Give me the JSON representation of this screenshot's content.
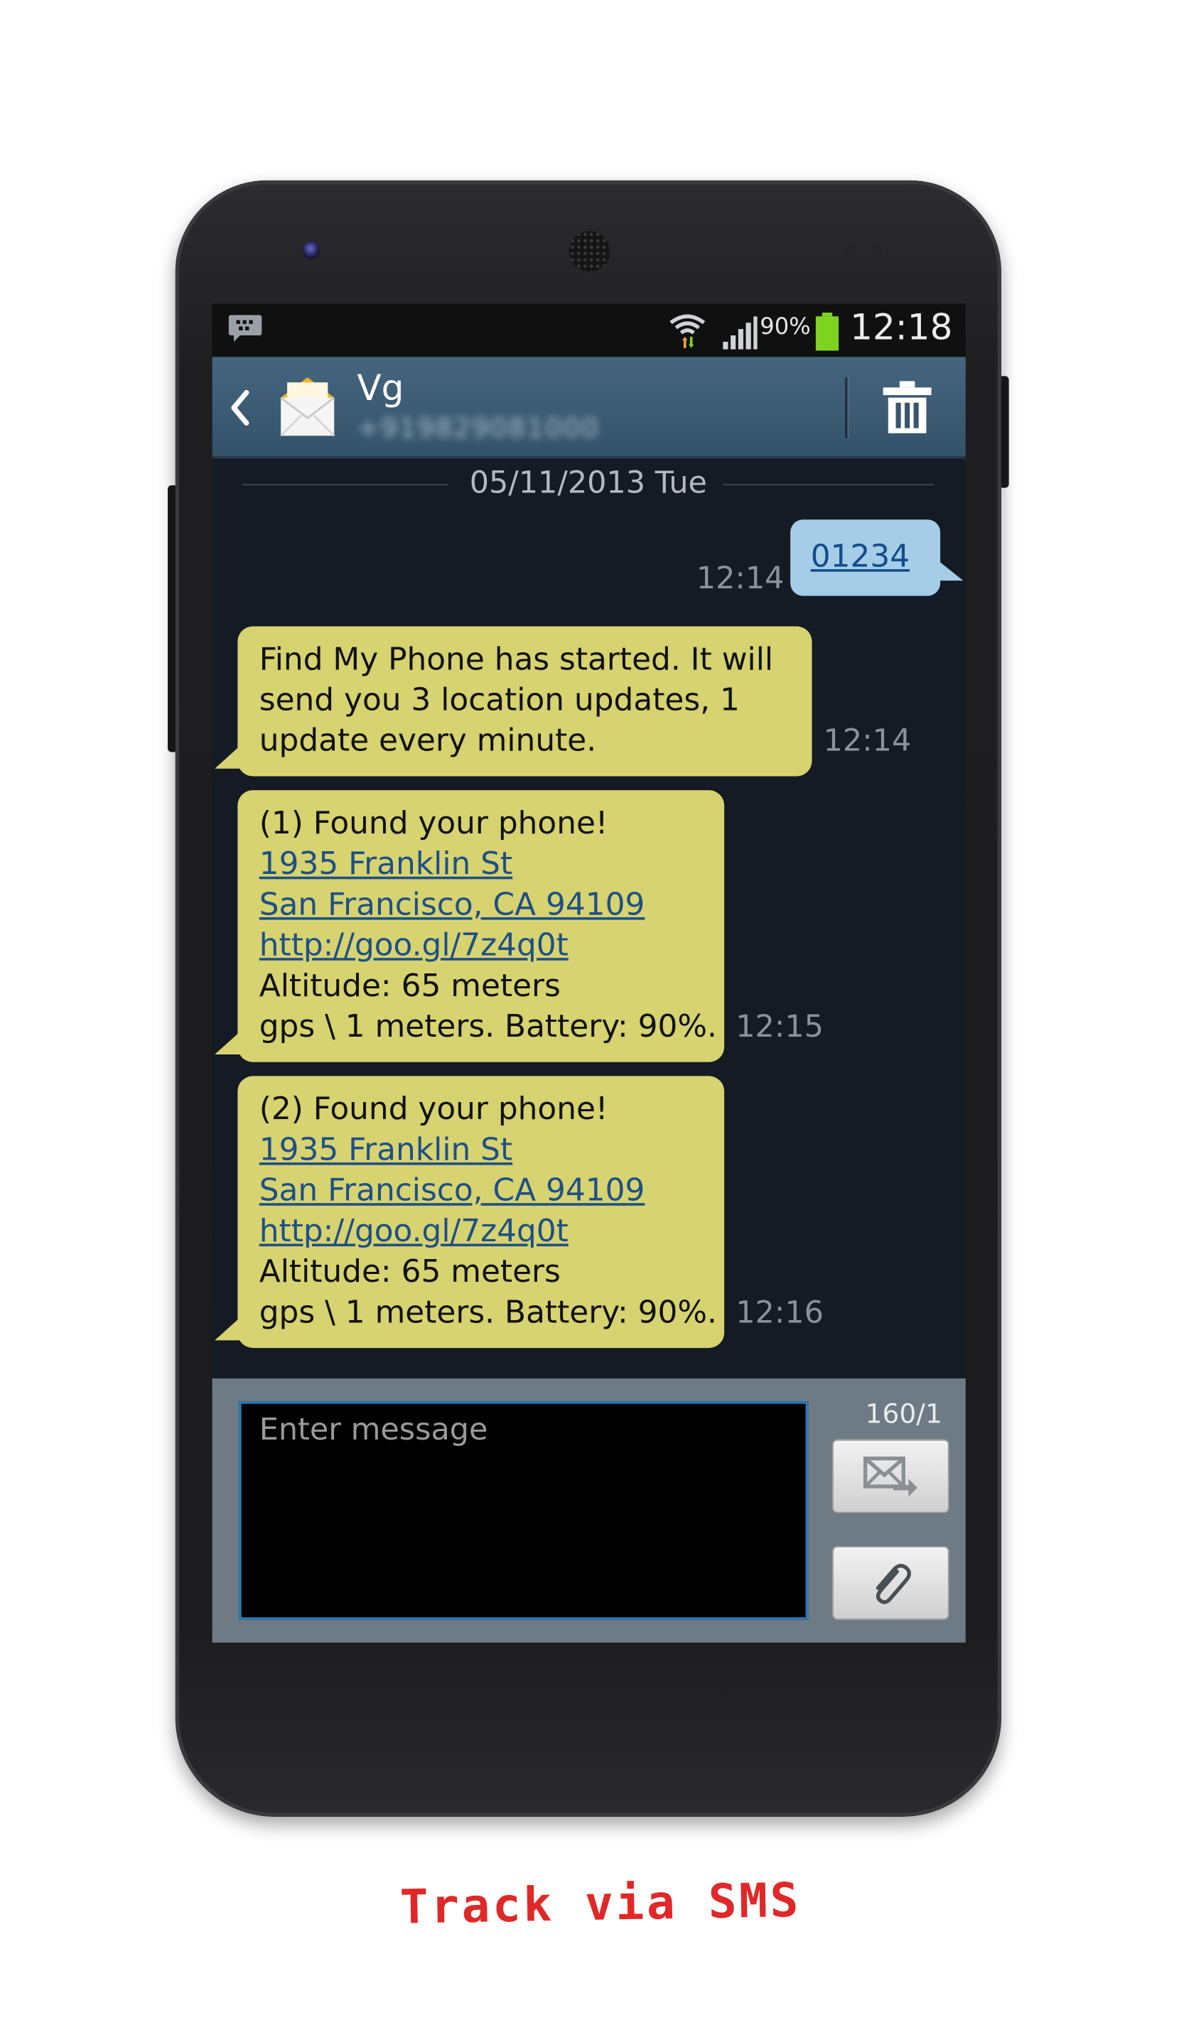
{
  "status_bar": {
    "battery_percent": "90%",
    "clock": "12:18",
    "icons": [
      "bbm-icon",
      "wifi-icon",
      "signal-icon",
      "battery-icon"
    ]
  },
  "action_bar": {
    "contact_name": "Vg",
    "contact_number": "+919829081000",
    "icons": [
      "back-icon",
      "envelope-icon",
      "trash-icon"
    ]
  },
  "conversation": {
    "date": "05/11/2013 Tue",
    "sent": {
      "text": "01234",
      "time": "12:14"
    },
    "received": [
      {
        "time": "12:14",
        "lines": [
          "Find My Phone has started. It will",
          "send you 3 location updates, 1",
          "update every minute."
        ]
      },
      {
        "time": "12:15",
        "heading": "(1) Found your phone!",
        "address1": "1935 Franklin St",
        "address2": "San Francisco, CA 94109",
        "url": "http://goo.gl/7z4q0t",
        "altitude": "Altitude: 65 meters",
        "gps": "gps \\ 1 meters. Battery: 90%."
      },
      {
        "time": "12:16",
        "heading": "(2) Found your phone!",
        "address1": "1935 Franklin St",
        "address2": "San Francisco, CA 94109",
        "url": "http://goo.gl/7z4q0t",
        "altitude": "Altitude: 65 meters",
        "gps": "gps \\ 1 meters. Battery: 90%."
      }
    ]
  },
  "compose": {
    "placeholder": "Enter message",
    "char_count": "160/1",
    "icons": [
      "send-icon",
      "paperclip-icon"
    ]
  },
  "caption": "Track via SMS",
  "colors": {
    "incoming_bubble": "#d6d370",
    "outgoing_bubble": "#a5cde8",
    "screen_background": "#141b24",
    "action_bar": "#3b5a72",
    "caption": "#e02828",
    "battery": "#7ed321"
  }
}
